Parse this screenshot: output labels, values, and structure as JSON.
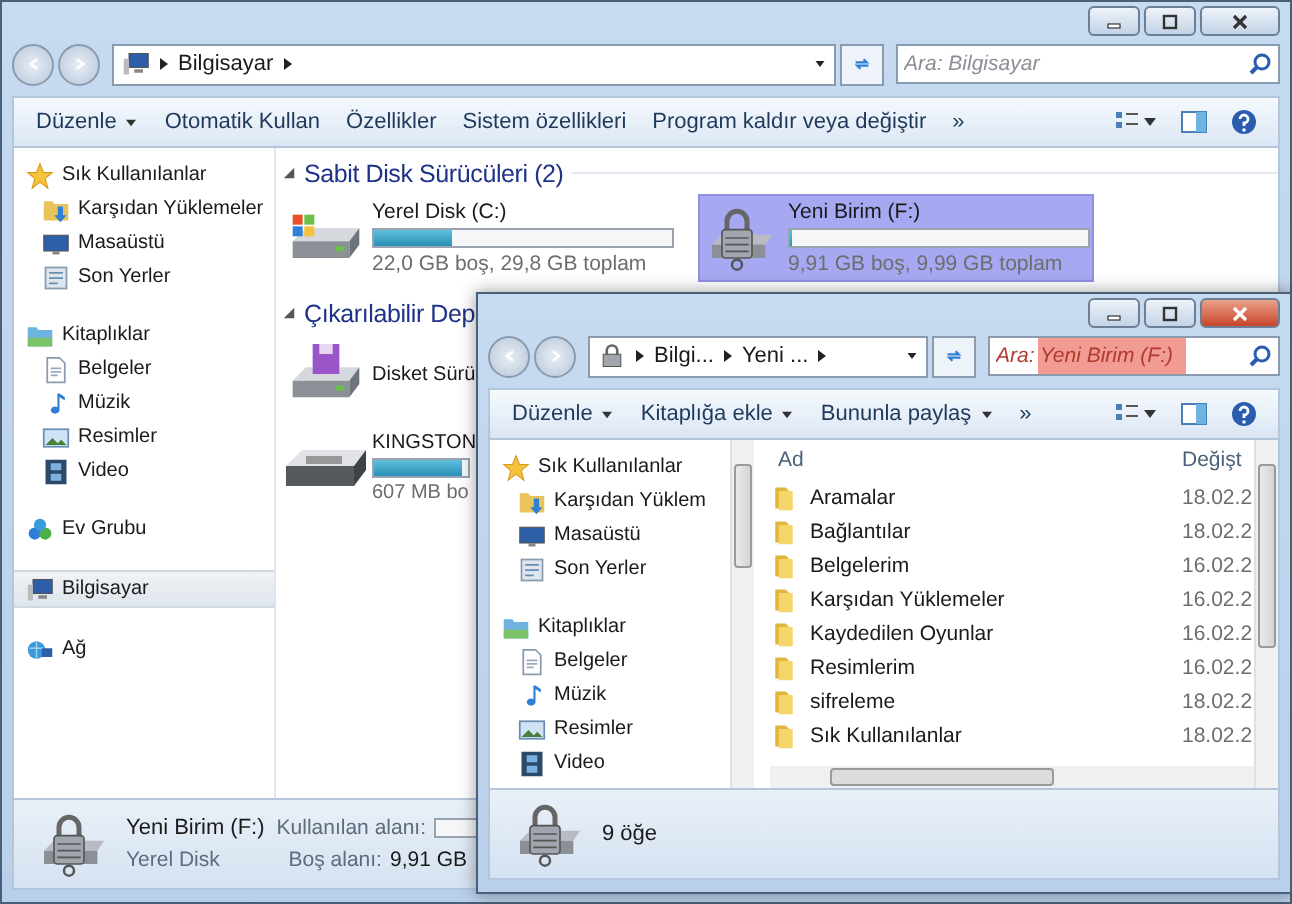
{
  "back_window": {
    "breadcrumbs": [
      "Bilgisayar"
    ],
    "search": {
      "placeholder": "Ara: Bilgisayar"
    },
    "toolbar": [
      {
        "label": "Düzenle",
        "menu": true
      },
      {
        "label": "Otomatik Kullan",
        "menu": false
      },
      {
        "label": "Özellikler",
        "menu": false
      },
      {
        "label": "Sistem özellikleri",
        "menu": false
      },
      {
        "label": "Program kaldır veya değiştir",
        "menu": false
      }
    ],
    "overflow": "»",
    "nav": [
      {
        "label": "Sık Kullanılanlar",
        "selected": false,
        "children": [
          {
            "label": "Karşıdan Yüklemeler",
            "selected": false
          },
          {
            "label": "Masaüstü",
            "selected": false
          },
          {
            "label": "Son Yerler",
            "selected": false
          }
        ]
      },
      {
        "label": "Kitaplıklar",
        "selected": false,
        "children": [
          {
            "label": "Belgeler",
            "selected": false
          },
          {
            "label": "Müzik",
            "selected": false
          },
          {
            "label": "Resimler",
            "selected": false
          },
          {
            "label": "Video",
            "selected": false
          }
        ]
      },
      {
        "label": "Ev Grubu",
        "selected": false
      },
      {
        "label": "Bilgisayar",
        "selected": true
      },
      {
        "label": "Ağ",
        "selected": false
      }
    ],
    "sections": [
      {
        "title": "Sabit Disk Sürücüleri (2)",
        "drives": [
          {
            "name": "Yerel Disk (C:)",
            "level": 0.26,
            "info": "22,0 GB boş, 29,8 GB toplam",
            "selected": false
          },
          {
            "name": "Yeni Birim (F:)",
            "level": 0.01,
            "info": "9,91 GB boş, 9,99 GB toplam",
            "selected": true
          }
        ]
      },
      {
        "title": "Çıkarılabilir Dep",
        "drives": [
          {
            "name": "Disket Sürü",
            "selected": false
          },
          {
            "name": "KINGSTON",
            "level": 0.94,
            "info": "607 MB bo",
            "selected": false
          }
        ]
      }
    ],
    "details": {
      "name": "Yeni Birim (F:)",
      "type": "Yerel Disk",
      "used_label": "Kullanılan alanı:",
      "level": 0.01,
      "free_label": "Boş alanı:",
      "free": "9,91 GB"
    }
  },
  "front_window": {
    "breadcrumbs": [
      "Bilgi...",
      "Yeni ..."
    ],
    "search": {
      "placeholder": "Ara: Yeni Birim (F:)",
      "highlighted": true
    },
    "toolbar": [
      {
        "label": "Düzenle",
        "menu": true
      },
      {
        "label": "Kitaplığa ekle",
        "menu": true
      },
      {
        "label": "Bununla paylaş",
        "menu": true
      }
    ],
    "overflow": "»",
    "nav": [
      {
        "label": "Sık Kullanılanlar",
        "selected": false,
        "children": [
          {
            "label": "Karşıdan Yüklem",
            "selected": false
          },
          {
            "label": "Masaüstü",
            "selected": false
          },
          {
            "label": "Son Yerler",
            "selected": false
          }
        ]
      },
      {
        "label": "Kitaplıklar",
        "selected": false,
        "children": [
          {
            "label": "Belgeler",
            "selected": false
          },
          {
            "label": "Müzik",
            "selected": false
          },
          {
            "label": "Resimler",
            "selected": false
          },
          {
            "label": "Video",
            "selected": false
          }
        ]
      }
    ],
    "columns": [
      "Ad",
      "Değişt"
    ],
    "rows": [
      {
        "name": "Aramalar",
        "date": "18.02.2",
        "selected": false
      },
      {
        "name": "Bağlantılar",
        "date": "18.02.2",
        "selected": false
      },
      {
        "name": "Belgelerim",
        "date": "16.02.2",
        "selected": false
      },
      {
        "name": "Karşıdan Yüklemeler",
        "date": "16.02.2",
        "selected": false
      },
      {
        "name": "Kaydedilen Oyunlar",
        "date": "16.02.2",
        "selected": false
      },
      {
        "name": "Resimlerim",
        "date": "16.02.2",
        "selected": false
      },
      {
        "name": "sifreleme",
        "date": "18.02.2",
        "selected": false
      },
      {
        "name": "Sık Kullanılanlar",
        "date": "18.02.2",
        "selected": false
      }
    ],
    "status": "9 öğe"
  }
}
